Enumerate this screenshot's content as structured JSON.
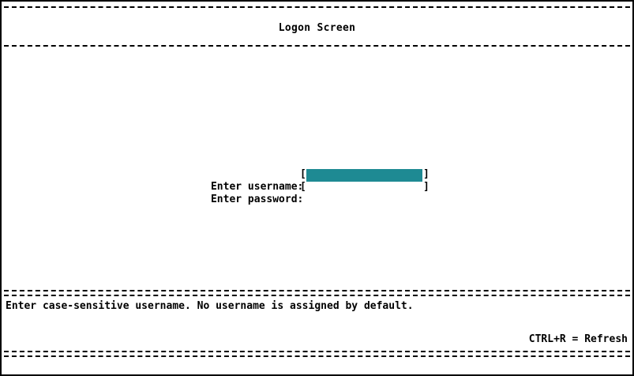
{
  "screen": {
    "title": "Logon Screen"
  },
  "form": {
    "username_label": "Enter username:",
    "password_label": "Enter password:",
    "bracket_open": "[",
    "bracket_close": "]",
    "username_value": "",
    "password_value": ""
  },
  "footer": {
    "help_text": "Enter case-sensitive username. No username is assigned by default.",
    "hotkey_text": "CTRL+R = Refresh"
  },
  "colors": {
    "field_highlight": "#1e8a93",
    "text": "#000000",
    "background": "#ffffff"
  }
}
